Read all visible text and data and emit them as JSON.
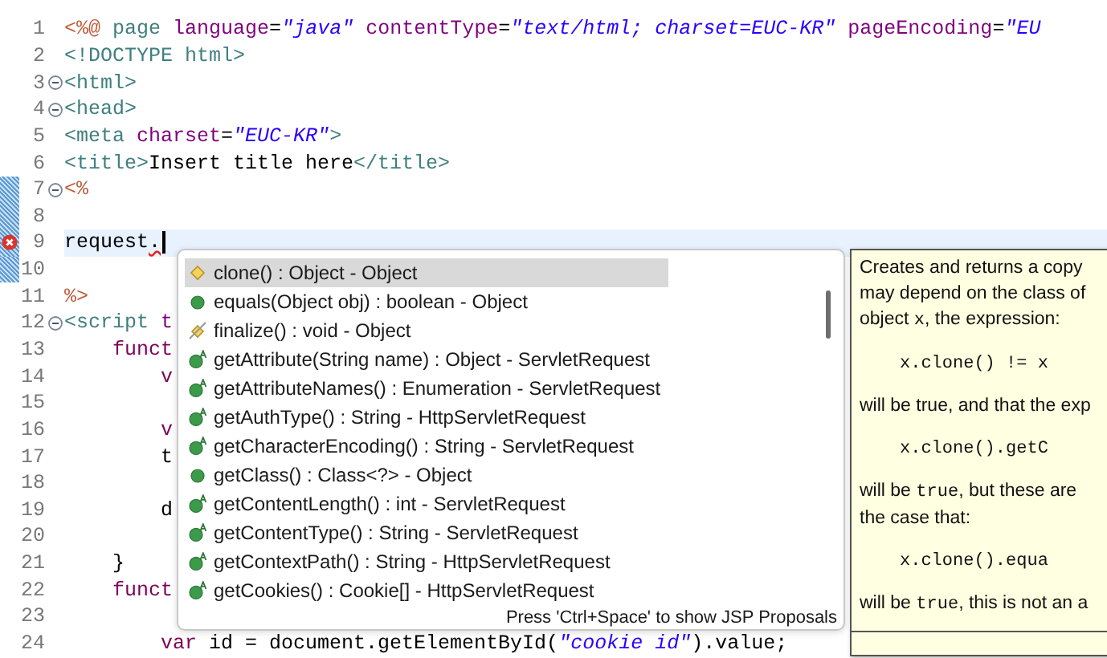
{
  "editor": {
    "lines": [
      {
        "number": "1",
        "fold": false,
        "error": false,
        "current": false,
        "changed": false,
        "tokens": [
          {
            "text": "<%@",
            "kind": "jsp"
          },
          {
            "text": " page ",
            "kind": "tag"
          },
          {
            "text": "language",
            "kind": "attr"
          },
          {
            "text": "=",
            "kind": "text"
          },
          {
            "text": "\"java\"",
            "kind": "value"
          },
          {
            "text": " contentType",
            "kind": "attr"
          },
          {
            "text": "=",
            "kind": "text"
          },
          {
            "text": "\"text/html; charset=EUC-KR\"",
            "kind": "value"
          },
          {
            "text": " pageEncoding",
            "kind": "attr"
          },
          {
            "text": "=",
            "kind": "text"
          },
          {
            "text": "\"EU",
            "kind": "value"
          }
        ]
      },
      {
        "number": "2",
        "fold": false,
        "error": false,
        "current": false,
        "changed": false,
        "tokens": [
          {
            "text": "<!DOCTYPE html>",
            "kind": "tag"
          }
        ]
      },
      {
        "number": "3",
        "fold": true,
        "error": false,
        "current": false,
        "changed": false,
        "tokens": [
          {
            "text": "<html>",
            "kind": "tag"
          }
        ]
      },
      {
        "number": "4",
        "fold": true,
        "error": false,
        "current": false,
        "changed": false,
        "tokens": [
          {
            "text": "<head>",
            "kind": "tag"
          }
        ]
      },
      {
        "number": "5",
        "fold": false,
        "error": false,
        "current": false,
        "changed": false,
        "tokens": [
          {
            "text": "<meta ",
            "kind": "tag"
          },
          {
            "text": "charset",
            "kind": "attr"
          },
          {
            "text": "=",
            "kind": "text"
          },
          {
            "text": "\"EUC-KR\"",
            "kind": "value"
          },
          {
            "text": ">",
            "kind": "tag"
          }
        ]
      },
      {
        "number": "6",
        "fold": false,
        "error": false,
        "current": false,
        "changed": false,
        "tokens": [
          {
            "text": "<title>",
            "kind": "tag"
          },
          {
            "text": "Insert title here",
            "kind": "text"
          },
          {
            "text": "</title>",
            "kind": "tag"
          }
        ]
      },
      {
        "number": "7",
        "fold": true,
        "error": false,
        "current": false,
        "changed": true,
        "tokens": [
          {
            "text": "<%",
            "kind": "jsp"
          }
        ]
      },
      {
        "number": "8",
        "fold": false,
        "error": false,
        "current": false,
        "changed": true
      },
      {
        "number": "9",
        "fold": false,
        "error": true,
        "current": true,
        "changed": true,
        "tokens": [
          {
            "text": "request",
            "kind": "text"
          },
          {
            "text": ".",
            "kind": "error"
          }
        ]
      },
      {
        "number": "10",
        "fold": false,
        "error": false,
        "current": false,
        "changed": true
      },
      {
        "number": "11",
        "fold": false,
        "error": false,
        "current": false,
        "changed": false,
        "tokens": [
          {
            "text": "%>",
            "kind": "jsp"
          }
        ]
      },
      {
        "number": "12",
        "fold": true,
        "error": false,
        "current": false,
        "changed": false,
        "tokens": [
          {
            "text": "<script",
            "kind": "tag"
          },
          {
            "text": " t",
            "kind": "attr"
          }
        ]
      },
      {
        "number": "13",
        "fold": false,
        "error": false,
        "current": false,
        "changed": false,
        "tokens": [
          {
            "text": "    funct",
            "kind": "keyword"
          }
        ]
      },
      {
        "number": "14",
        "fold": false,
        "error": false,
        "current": false,
        "changed": false,
        "tokens": [
          {
            "text": "        v",
            "kind": "keyword"
          }
        ]
      },
      {
        "number": "15",
        "fold": false,
        "error": false,
        "current": false,
        "changed": false
      },
      {
        "number": "16",
        "fold": false,
        "error": false,
        "current": false,
        "changed": false,
        "tokens": [
          {
            "text": "        v",
            "kind": "keyword"
          }
        ]
      },
      {
        "number": "17",
        "fold": false,
        "error": false,
        "current": false,
        "changed": false,
        "tokens": [
          {
            "text": "        t",
            "kind": "text"
          }
        ]
      },
      {
        "number": "18",
        "fold": false,
        "error": false,
        "current": false,
        "changed": false
      },
      {
        "number": "19",
        "fold": false,
        "error": false,
        "current": false,
        "changed": false,
        "tokens": [
          {
            "text": "        d",
            "kind": "text"
          }
        ]
      },
      {
        "number": "20",
        "fold": false,
        "error": false,
        "current": false,
        "changed": false
      },
      {
        "number": "21",
        "fold": false,
        "error": false,
        "current": false,
        "changed": false,
        "tokens": [
          {
            "text": "    }",
            "kind": "text"
          }
        ]
      },
      {
        "number": "22",
        "fold": false,
        "error": false,
        "current": false,
        "changed": false,
        "tokens": [
          {
            "text": "    funct",
            "kind": "keyword"
          }
        ]
      },
      {
        "number": "23",
        "fold": false,
        "error": false,
        "current": false,
        "changed": false
      },
      {
        "number": "24",
        "fold": false,
        "error": false,
        "current": false,
        "changed": false,
        "tokens": [
          {
            "text": "        var",
            "kind": "keyword"
          },
          {
            "text": " id = document.getElementById(",
            "kind": "text"
          },
          {
            "text": "\"cookie id\"",
            "kind": "value"
          },
          {
            "text": ").value;",
            "kind": "text"
          }
        ]
      }
    ]
  },
  "proposals": {
    "items": [
      {
        "label": "clone() : Object - Object",
        "kind": "protected",
        "selected": true
      },
      {
        "label": "equals(Object obj) : boolean - Object",
        "kind": "public",
        "selected": false
      },
      {
        "label": "finalize() : void - Object",
        "kind": "deprecated",
        "selected": false
      },
      {
        "label": "getAttribute(String name) : Object - ServletRequest",
        "kind": "abstract",
        "selected": false
      },
      {
        "label": "getAttributeNames() : Enumeration - ServletRequest",
        "kind": "abstract",
        "selected": false
      },
      {
        "label": "getAuthType() : String - HttpServletRequest",
        "kind": "abstract",
        "selected": false
      },
      {
        "label": "getCharacterEncoding() : String - ServletRequest",
        "kind": "abstract",
        "selected": false
      },
      {
        "label": "getClass() : Class<?> - Object",
        "kind": "public",
        "selected": false
      },
      {
        "label": "getContentLength() : int - ServletRequest",
        "kind": "abstract",
        "selected": false
      },
      {
        "label": "getContentType() : String - ServletRequest",
        "kind": "abstract",
        "selected": false
      },
      {
        "label": "getContextPath() : String - HttpServletRequest",
        "kind": "abstract",
        "selected": false
      },
      {
        "label": "getCookies() : Cookie[] - HttpServletRequest",
        "kind": "abstract",
        "selected": false
      }
    ],
    "footer": "Press 'Ctrl+Space' to show JSP Proposals"
  },
  "documentation": {
    "lines": [
      {
        "kind": "prose",
        "parts": [
          {
            "text": "Creates and returns a copy",
            "mono": false
          }
        ]
      },
      {
        "kind": "prose",
        "parts": [
          {
            "text": "may depend on the class of",
            "mono": false
          }
        ]
      },
      {
        "kind": "prose",
        "parts": [
          {
            "text": "object ",
            "mono": false
          },
          {
            "text": "x",
            "mono": true
          },
          {
            "text": ", the expression:",
            "mono": false
          }
        ]
      },
      {
        "kind": "code",
        "parts": [
          {
            "text": "x.clone() != x",
            "mono": true
          }
        ]
      },
      {
        "kind": "prose",
        "parts": [
          {
            "text": "will be true, and that the exp",
            "mono": false
          }
        ]
      },
      {
        "kind": "code",
        "parts": [
          {
            "text": "x.clone().getC",
            "mono": true
          }
        ]
      },
      {
        "kind": "prose",
        "parts": [
          {
            "text": "will be ",
            "mono": false
          },
          {
            "text": "true",
            "mono": true
          },
          {
            "text": ", but these are",
            "mono": false
          }
        ]
      },
      {
        "kind": "prose",
        "parts": [
          {
            "text": "the case that:",
            "mono": false
          }
        ]
      },
      {
        "kind": "code",
        "parts": [
          {
            "text": "x.clone().equa",
            "mono": true
          }
        ]
      },
      {
        "kind": "prose",
        "parts": [
          {
            "text": "will be ",
            "mono": false
          },
          {
            "text": "true",
            "mono": true
          },
          {
            "text": ", this is not an a",
            "mono": false
          }
        ]
      }
    ]
  }
}
